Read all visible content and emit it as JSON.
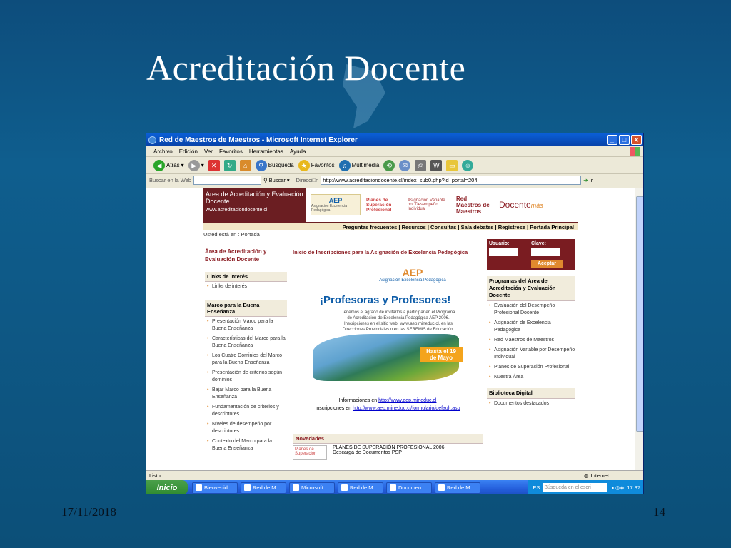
{
  "slide": {
    "title": "Acreditación Docente",
    "date": "17/11/2018",
    "page_number": "14"
  },
  "window": {
    "title": "Red de Maestros de Maestros - Microsoft Internet Explorer",
    "menu": [
      "Archivo",
      "Edición",
      "Ver",
      "Favoritos",
      "Herramientas",
      "Ayuda"
    ],
    "toolbar": {
      "back": "Atrás",
      "search": "Búsqueda",
      "favorites": "Favoritos",
      "media": "Multimedia"
    },
    "searchbar": {
      "label": "Buscar en la Web",
      "button": "Buscar"
    },
    "address": {
      "label": "Direcci□n",
      "url": "http://www.acreditaciondocente.cl/index_sub0.php?id_portal=204",
      "go": "Ir"
    }
  },
  "site": {
    "banner": {
      "title": "Área de Acreditación y Evaluación Docente",
      "url": "www.acreditaciondocente.cl"
    },
    "logos": {
      "aep": "AEP",
      "aep_sub": "Asignación Excelencia Pedagógica",
      "planes": "Planes de Superación Profesional",
      "asig": "Asignación Variable por Desempeño Individual",
      "red": "Red Maestros de Maestros",
      "docente": "Docente",
      "docente_more": "más"
    },
    "nav": "Preguntas frecuentes  |  Recursos  |  Consultas  |  Sala debates  |  Regístrese  |  Portada Principal",
    "breadcrumb": "Usted está en : Portada",
    "left": {
      "heading": "Área de Acreditación y Evaluación Docente",
      "links_title": "Links de interés",
      "links": [
        "Links de interés"
      ],
      "marco_title": "Marco para la Buena Enseñanza",
      "marco_items": [
        "Presentación Marco para la Buena Enseñanza",
        "Características del Marco para la Buena Enseñanza",
        "Los Cuatro Dominios del Marco para la Buena Enseñanza",
        "Presentación de criterios según dominios",
        "Bajar Marco para la Buena Enseñanza",
        "Fundamentación de criterios y descriptores",
        "Niveles de desempeño por descriptores",
        "Contexto del Marco para la Buena Enseñanza"
      ]
    },
    "center": {
      "heading": "Inicio de Inscripciones para la Asignación de Excelencia Pedagógica",
      "poster_title": "¡Profesoras y Profesores!",
      "poster_text": "Tenemos el agrado de invitarlos a participar en el Programa de Acreditación de Excelencia Pedagógica AEP 2006. Inscripciones en el sitio web: www.aep.mineduc.cl, en las Direcciones Provinciales o en las SEREMIS de Educación.",
      "poster_until": "Hasta el 19 de Mayo",
      "info_label": "Informaciones en",
      "info_url": "http://www.aep.mineduc.cl",
      "insc_label": "Inscripciones en",
      "insc_url": "http://www.aep.mineduc.cl/formulario/default.asp",
      "novedades": "Novedades",
      "nov_img": "Planes de Superación",
      "nov_line1": "PLANES DE SUPERACIÓN PROFESIONAL 2006",
      "nov_line2": "Descarga de Documentos PSP"
    },
    "right": {
      "user_label": "Usuario:",
      "pass_label": "Clave:",
      "accept": "Aceptar",
      "programs_title": "Programas del Área de Acreditación y Evaluación Docente",
      "programs": [
        "Evaluación del Desempeño Profesional Docente",
        "Asignación de Excelencia Pedagógica",
        "Red Maestros de Maestros",
        "Asignación Variable por Desempeño Individual",
        "Planes de Superación Profesional",
        "Nuestra Área"
      ],
      "library_title": "Biblioteca Digital",
      "library": [
        "Documentos destacados"
      ]
    }
  },
  "status": {
    "text": "Listo",
    "zone": "Internet"
  },
  "taskbar": {
    "start": "Inicio",
    "tasks": [
      "Bienvenid...",
      "Red de M...",
      "Microsoft ...",
      "Red de M...",
      "Documen...",
      "Red de M..."
    ],
    "lang": "ES",
    "search_placeholder": "Búsqueda en el escri",
    "clock": "17:37"
  }
}
